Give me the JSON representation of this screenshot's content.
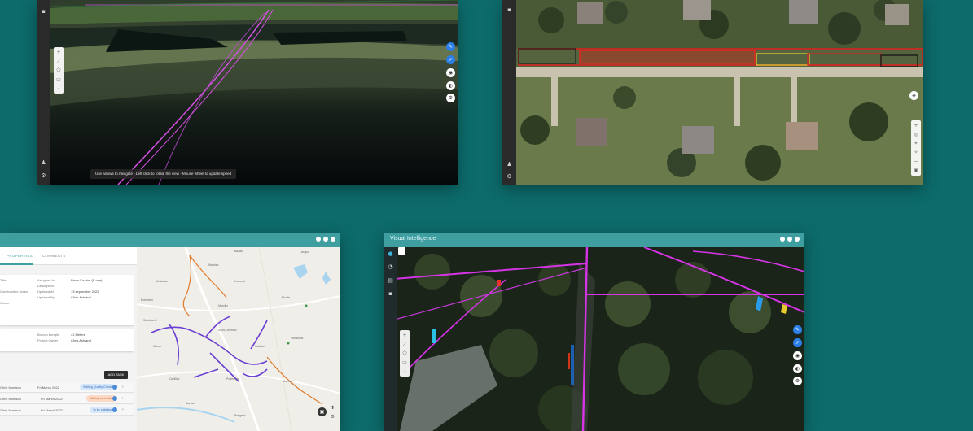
{
  "windows": {
    "pointcloud": {
      "hint_text": "Use arrows to navigate - Left click to rotate the view - Mouse wheel to update speed"
    },
    "aerial": {},
    "tasks": {
      "tabs": [
        "PROPERTIES",
        "COMMENTS"
      ],
      "card1": {
        "left_labels": [
          "Title",
          "",
          "Construction Notes",
          "",
          "Owner"
        ],
        "mid_labels": [
          "Assigned to",
          "Description",
          "Updated At",
          "Updated By"
        ],
        "values": [
          "Paolo Kazzini (E.one)",
          "",
          "13 septembre 2022",
          "Chris Ashland"
        ]
      },
      "card2": {
        "mid_labels": [
          "Branch Length",
          "Project Owner"
        ],
        "values": [
          "41 Meters",
          "Chris Ashland"
        ]
      },
      "add_task_label": "ADD TASK",
      "task_rows": [
        {
          "owner": "Chris Morrison",
          "date": "Fri March 2022",
          "status": "Waiting Quality Check",
          "status_color": "blue"
        },
        {
          "owner": "Chris Morrison",
          "date": "Fri March 2022",
          "status": "Waiting correction",
          "status_color": "orange"
        },
        {
          "owner": "Chris Morrison",
          "date": "Fri March 2022",
          "status": "To be validated",
          "status_color": "blue"
        }
      ],
      "map_places": [
        "Mirabeau",
        "Mauriac",
        "Bazas",
        "Langon",
        "Lormont",
        "Moulis",
        "Bonnetan",
        "Marcilly",
        "Salleboeuf",
        "Saint-Germain",
        "Sadirac",
        "Créon",
        "Verdelais",
        "Cadillac",
        "Podensac",
        "Cérons",
        "Barsac",
        "Preignac"
      ]
    },
    "visual": {
      "title": "Visual Intelligence"
    }
  }
}
